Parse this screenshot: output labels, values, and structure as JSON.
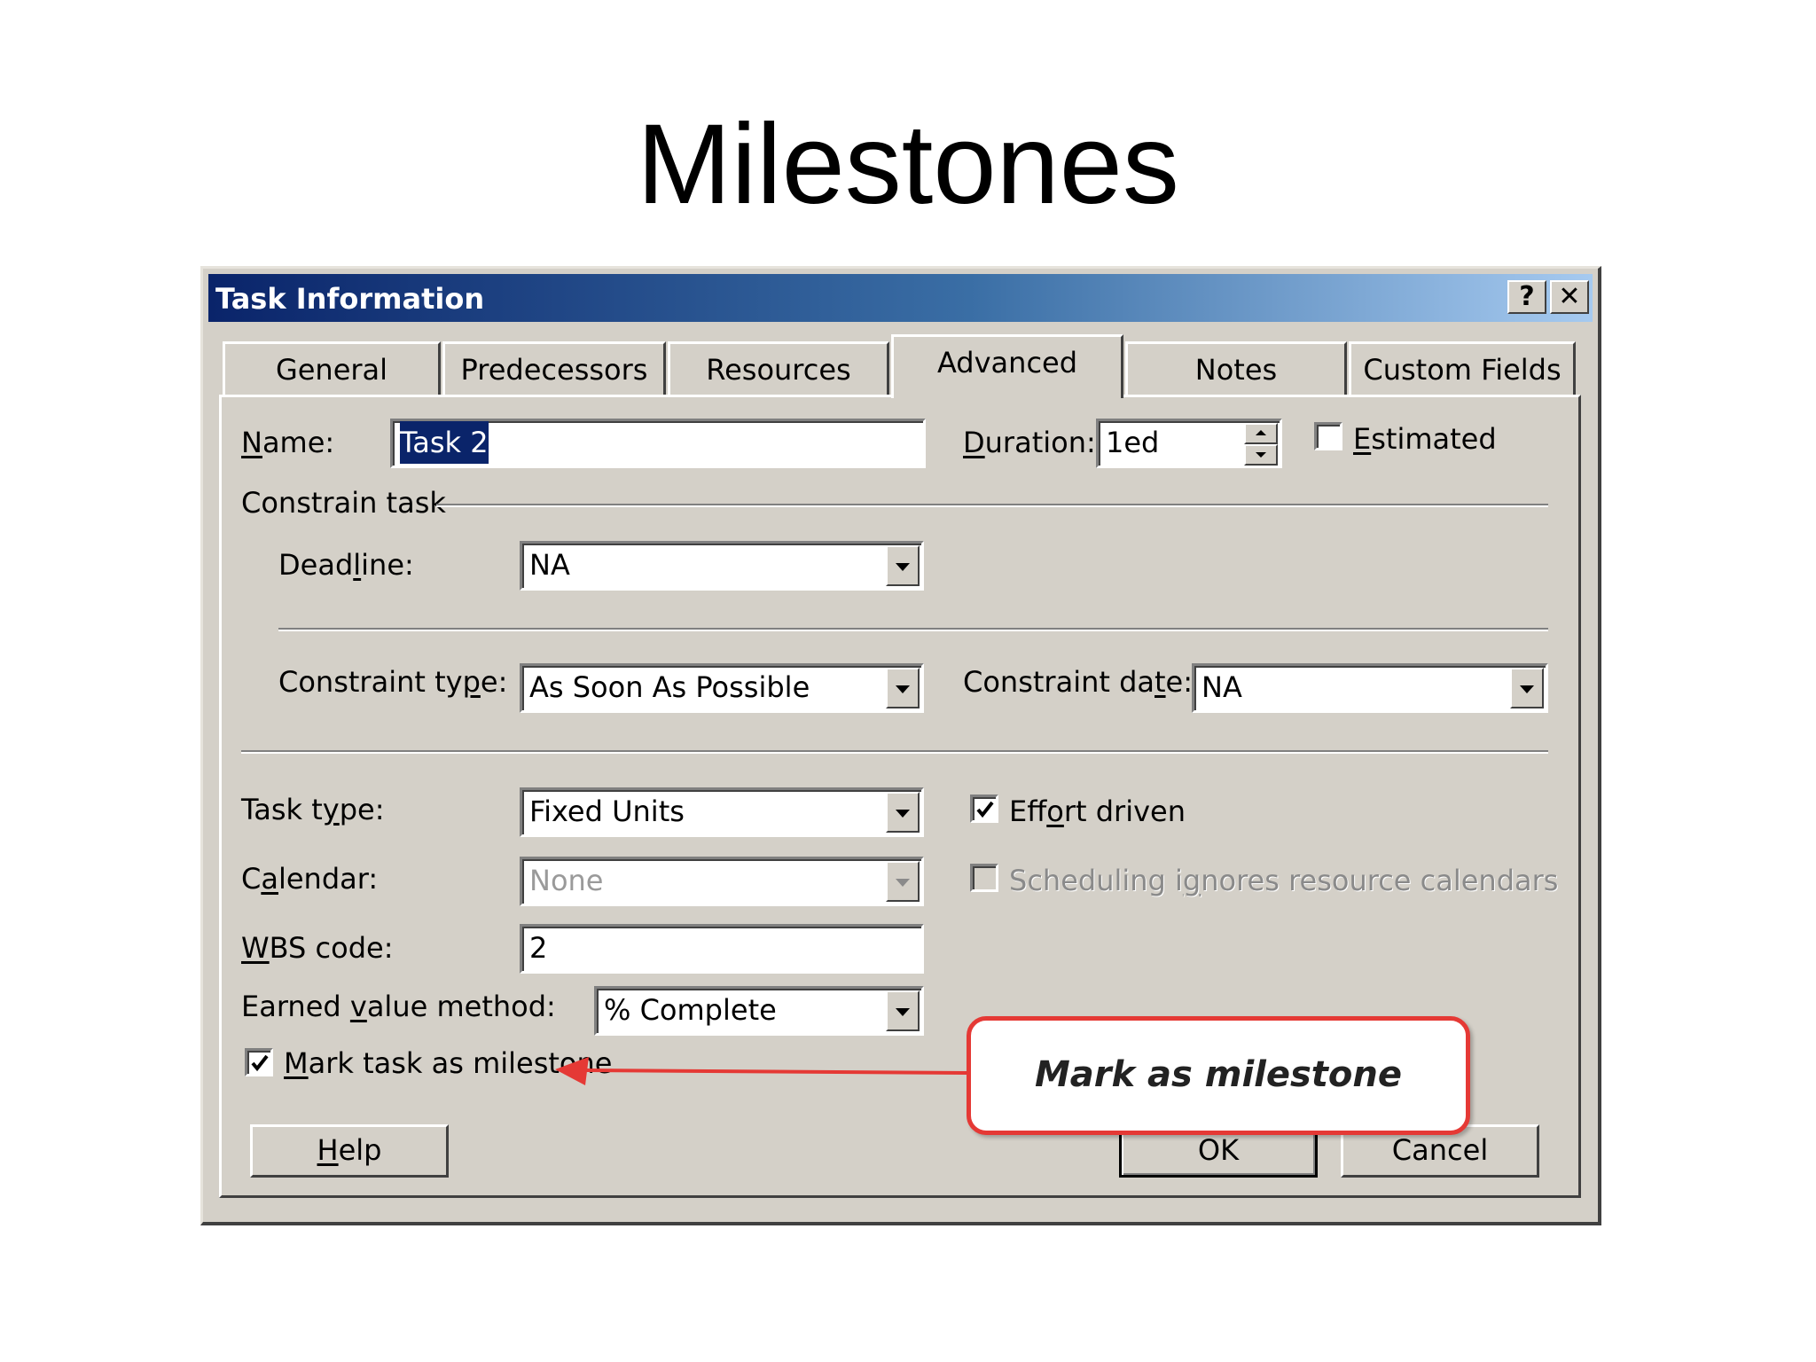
{
  "slide": {
    "title": "Milestones"
  },
  "dialog": {
    "title": "Task Information",
    "help_glyph": "?",
    "close_glyph": "✕"
  },
  "tabs": [
    {
      "label": "General"
    },
    {
      "label": "Predecessors"
    },
    {
      "label": "Resources"
    },
    {
      "label": "Advanced",
      "active": true
    },
    {
      "label": "Notes"
    },
    {
      "label": "Custom Fields"
    }
  ],
  "fields": {
    "name": {
      "label_u": "N",
      "label_rest": "ame:",
      "value": "Task 2"
    },
    "duration": {
      "label_u": "D",
      "label_rest": "uration:",
      "value": "1ed"
    },
    "estimated": {
      "label_u": "E",
      "label_rest": "stimated",
      "checked": false
    },
    "constrain_group": {
      "label": "Constrain task"
    },
    "deadline": {
      "label_pre": "Dead",
      "label_u": "l",
      "label_rest": "ine:",
      "value": "NA"
    },
    "constraint_type": {
      "label_pre": "Constraint ty",
      "label_u": "p",
      "label_rest": "e:",
      "value": "As Soon As Possible"
    },
    "constraint_date": {
      "label_pre": "Constraint da",
      "label_u": "t",
      "label_rest": "e:",
      "value": "NA"
    },
    "task_type": {
      "label_pre": "Task t",
      "label_u": "y",
      "label_rest": "pe:",
      "value": "Fixed Units"
    },
    "effort_driven": {
      "label_pre": "Eff",
      "label_u": "o",
      "label_rest": "rt driven",
      "checked": true
    },
    "calendar": {
      "label_pre": "C",
      "label_u": "a",
      "label_rest": "lendar:",
      "value": "None",
      "disabled": true
    },
    "scheduling_ignores": {
      "label_pre": "Scheduling i",
      "label_u": "g",
      "label_rest": "nores resource calendars",
      "checked": false,
      "disabled": true
    },
    "wbs_code": {
      "label_u": "W",
      "label_rest": "BS code:",
      "value": "2"
    },
    "earned_value": {
      "label_pre": "Earned ",
      "label_u": "v",
      "label_rest": "alue method:",
      "value": "% Complete"
    },
    "milestone": {
      "label_u": "M",
      "label_rest": "ark task as milestone",
      "checked": true
    }
  },
  "buttons": {
    "help": {
      "label_u": "H",
      "label_rest": "elp"
    },
    "ok": {
      "label": "OK"
    },
    "cancel": {
      "label": "Cancel"
    }
  },
  "callout": {
    "text": "Mark as milestone",
    "color": "#e53935"
  },
  "colors": {
    "dialog_bg": "#d4d0c8",
    "titlebar_start": "#0a246a",
    "titlebar_end": "#a6caf0"
  }
}
